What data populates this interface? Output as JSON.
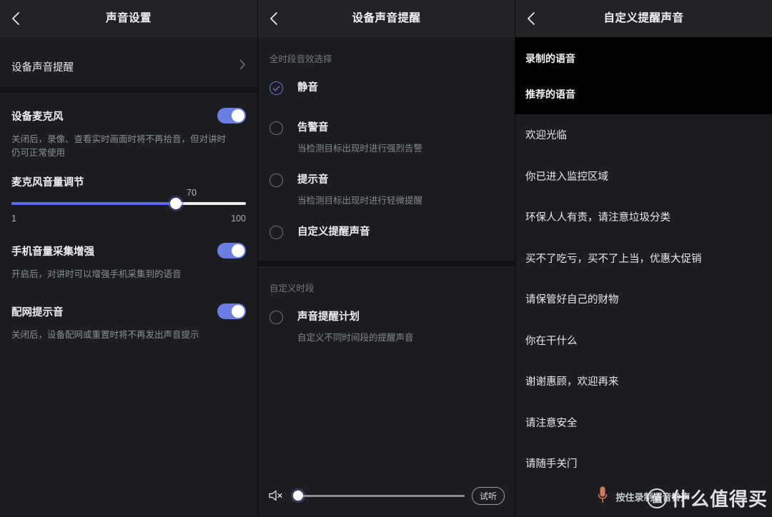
{
  "colors": {
    "accent": "#6b7fe2",
    "slider_fill": "#5b6ae0",
    "panel_bg": "#1c1d20",
    "header_bg": "#222326",
    "black": "#000000"
  },
  "panel1": {
    "title": "声音设置",
    "back_icon": "chevron-left-icon",
    "nav": {
      "label": "设备声音提醒",
      "chevron": "chevron-right-icon"
    },
    "mic_switch": {
      "label": "设备麦克风",
      "desc": "关闭后，录像、查看实时画面时将不再拾音，但对讲时仍可正常使用",
      "state": "on"
    },
    "volume": {
      "title": "麦克风音量调节",
      "value": "70",
      "min": "1",
      "max": "100",
      "percent": 70
    },
    "boost_switch": {
      "label": "手机音量采集增强",
      "desc": "开启后，对讲时可以增强手机采集到的语音",
      "state": "on"
    },
    "netcfg_switch": {
      "label": "配网提示音",
      "desc": "关闭后，设备配网或重置时将不再发出声音提示",
      "state": "on"
    }
  },
  "panel2": {
    "title": "设备声音提醒",
    "back_icon": "chevron-left-icon",
    "group1_label": "全时段音效选择",
    "options": [
      {
        "label": "静音",
        "desc": "",
        "selected": true
      },
      {
        "label": "告警音",
        "desc": "当检测目标出现时进行强烈告警",
        "selected": false
      },
      {
        "label": "提示音",
        "desc": "当检测目标出现时进行轻微提醒",
        "selected": false
      },
      {
        "label": "自定义提醒声音",
        "desc": "",
        "selected": false
      }
    ],
    "group2_label": "自定义时段",
    "schedule": {
      "label": "声音提醒计划",
      "desc": "自定义不同时间段的提醒声音",
      "selected": false
    },
    "bottom": {
      "speaker_icon": "speaker-mute-icon",
      "volume_percent": 0,
      "preview_label": "试听"
    }
  },
  "panel3": {
    "title": "自定义提醒声音",
    "back_icon": "chevron-left-icon",
    "section_recorded": "录制的语音",
    "section_recommended": "推荐的语音",
    "voices": [
      "欢迎光临",
      "你已进入监控区域",
      "环保人人有责，请注意垃圾分类",
      "买不了吃亏，买不了上当，优惠大促销",
      "请保管好自己的财物",
      "你在干什么",
      "谢谢惠顾，欢迎再来",
      "请注意安全",
      "请随手关门"
    ],
    "record": {
      "icon": "microphone-icon",
      "label": "按住录制语音铃声"
    }
  },
  "watermark": {
    "logo": "值",
    "text": "什么值得买"
  }
}
